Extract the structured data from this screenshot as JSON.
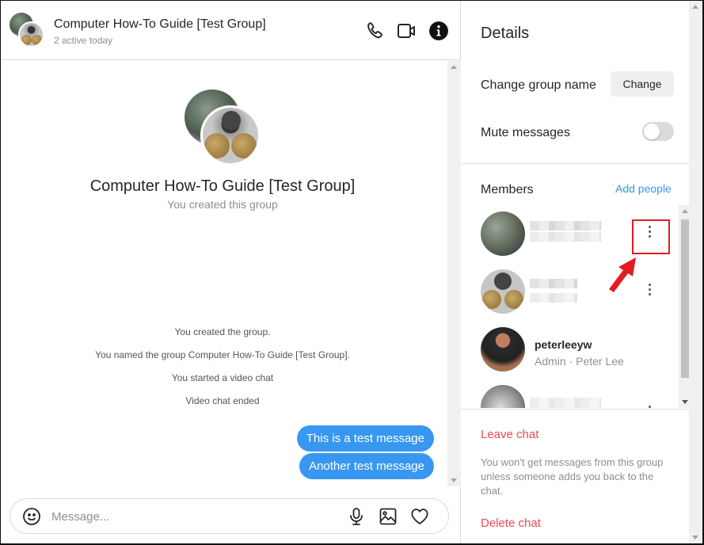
{
  "header": {
    "title": "Computer How-To Guide [Test Group]",
    "subtitle": "2 active today",
    "icons": [
      "phone-icon",
      "video-camera-icon",
      "info-icon"
    ]
  },
  "conversation": {
    "group_title": "Computer How-To Guide [Test Group]",
    "group_subtitle": "You created this group",
    "system_messages": [
      "You created the group.",
      "You named the group Computer How-To Guide [Test Group].",
      "You started a video chat",
      "Video chat ended"
    ],
    "messages": [
      {
        "text": "This is a test message",
        "sender": "me"
      },
      {
        "text": "Another test message",
        "sender": "me"
      }
    ]
  },
  "composer": {
    "placeholder": "Message...",
    "value": "",
    "icons": [
      "emoji-icon",
      "microphone-icon",
      "image-icon",
      "heart-icon"
    ]
  },
  "details": {
    "title": "Details",
    "change_group_name_label": "Change group name",
    "change_button": "Change",
    "mute_label": "Mute messages",
    "mute_enabled": false,
    "members_title": "Members",
    "add_people": "Add people",
    "members": [
      {
        "name": "",
        "subtitle": "",
        "blurred": true,
        "has_menu": true,
        "highlighted": true
      },
      {
        "name": "",
        "subtitle": "",
        "blurred": true,
        "has_menu": true,
        "highlighted": false
      },
      {
        "name": "peterleeyw",
        "subtitle": "Admin · Peter Lee",
        "blurred": false,
        "has_menu": false,
        "highlighted": false
      },
      {
        "name": "",
        "subtitle": "",
        "blurred": true,
        "has_menu": true,
        "highlighted": false
      }
    ],
    "leave_chat": "Leave chat",
    "leave_note": "You won't get messages from this group unless someone adds you back to the chat.",
    "delete_chat": "Delete chat"
  },
  "colors": {
    "accent": "#3897f0",
    "danger": "#ed4956",
    "annotation": "#e31b23"
  }
}
